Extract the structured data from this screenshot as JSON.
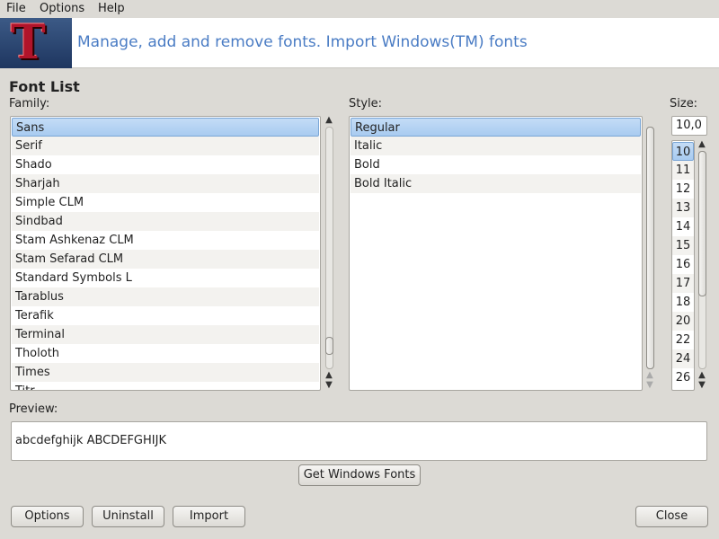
{
  "menubar": {
    "items": [
      "File",
      "Options",
      "Help"
    ]
  },
  "banner": {
    "logo_letter": "T",
    "title": "Manage, add and remove fonts. Import Windows(TM) fonts"
  },
  "font_list": {
    "title": "Font List",
    "family_label": "Family:",
    "style_label": "Style:",
    "size_label": "Size:",
    "families": [
      "Sans",
      "Serif",
      "Shado",
      "Sharjah",
      "Simple CLM",
      "Sindbad",
      "Stam Ashkenaz CLM",
      "Stam Sefarad CLM",
      "Standard Symbols L",
      "Tarablus",
      "Terafik",
      "Terminal",
      "Tholoth",
      "Times",
      "Titr"
    ],
    "selected_family": "Sans",
    "styles": [
      "Regular",
      "Italic",
      "Bold",
      "Bold Italic"
    ],
    "selected_style": "Regular",
    "size_value": "10,0",
    "sizes": [
      "10",
      "11",
      "12",
      "13",
      "14",
      "15",
      "16",
      "17",
      "18",
      "20",
      "22",
      "24",
      "26"
    ],
    "selected_size": "10"
  },
  "preview": {
    "label": "Preview:",
    "text": "abcdefghijk ABCDEFGHIJK"
  },
  "buttons": {
    "get_windows_fonts": "Get Windows Fonts",
    "options": "Options",
    "uninstall": "Uninstall",
    "import": "Import",
    "close": "Close"
  },
  "icons": {
    "up": "up-arrow-icon",
    "down": "down-arrow-icon"
  }
}
